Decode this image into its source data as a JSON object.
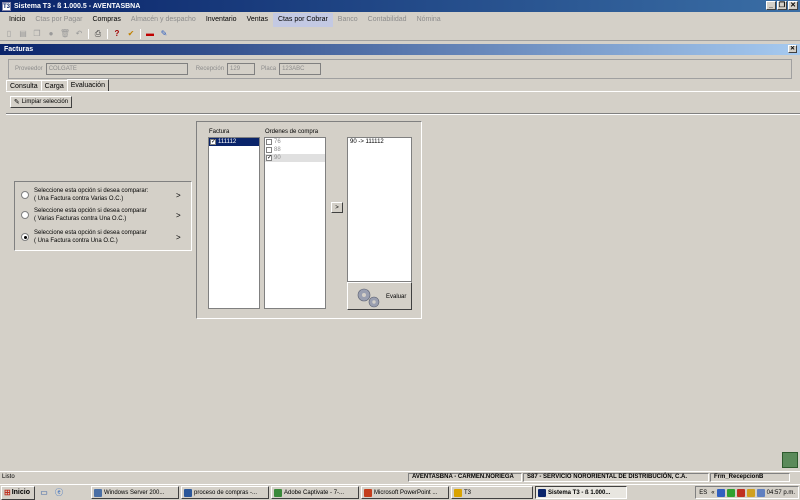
{
  "window": {
    "title": "Sistema T3 - ß 1.000.5 - AVENTASBNA",
    "app_icon_text": "T3",
    "min_label": "_",
    "restore_label": "❐",
    "close_label": "✕"
  },
  "menubar": {
    "items": [
      {
        "label": "Inicio",
        "state": "enabled"
      },
      {
        "label": "Ctas por Pagar",
        "state": "disabled"
      },
      {
        "label": "Compras",
        "state": "enabled"
      },
      {
        "label": "Almacén y despacho",
        "state": "disabled"
      },
      {
        "label": "Inventario",
        "state": "enabled"
      },
      {
        "label": "Ventas",
        "state": "enabled"
      },
      {
        "label": "Ctas por Cobrar",
        "state": "active"
      },
      {
        "label": "Banco",
        "state": "disabled"
      },
      {
        "label": "Contabilidad",
        "state": "disabled"
      },
      {
        "label": "Nómina",
        "state": "disabled"
      }
    ]
  },
  "toolbar": {
    "icons": [
      "new-icon",
      "save-icon",
      "copy-icon",
      "record-icon",
      "delete-icon",
      "undo-icon",
      "print-icon",
      "help-icon",
      "approve-icon",
      "exit-icon",
      "edit-icon"
    ]
  },
  "form": {
    "title": "Facturas",
    "close_label": "✕",
    "proveedor_label": "Proveedor",
    "proveedor_value": "COLGATE",
    "recepcion_label": "Recepción",
    "recepcion_value": "129",
    "placa_label": "Placa",
    "placa_value": "123ABC"
  },
  "tabs": [
    {
      "label": "Consulta",
      "selected": false
    },
    {
      "label": "Carga",
      "selected": false
    },
    {
      "label": "Evaluación",
      "selected": true
    }
  ],
  "clear_button": {
    "label": "Limpiar selección"
  },
  "options": [
    {
      "line1": "Seleccione esta opción si desea comparar:",
      "line2": "( Una Factura contra Varias O.C.)",
      "arrow": ">",
      "selected": false
    },
    {
      "line1": "Seleccione esta opción si desea comparar",
      "line2": "( Varias Facturas contra Una O.C.)",
      "arrow": ">",
      "selected": false
    },
    {
      "line1": "Seleccione esta opción si desea comparar",
      "line2": "( Una Factura contra Una O.C.)",
      "arrow": ">",
      "selected": true
    }
  ],
  "factura": {
    "label": "Factura",
    "items": [
      {
        "value": "111112",
        "checked": true
      }
    ]
  },
  "ordenes": {
    "label": "Ordenes de compra",
    "items": [
      {
        "value": "76",
        "checked": false
      },
      {
        "value": "88",
        "checked": false
      },
      {
        "value": "90",
        "checked": true
      }
    ]
  },
  "move_button": {
    "label": ">"
  },
  "results": {
    "items": [
      "90 -> 111112"
    ]
  },
  "evaluar_button": {
    "label": "Evaluar"
  },
  "status": {
    "left": "Listo",
    "user": "AVENTASBNA - CARMEN.NORIEGA",
    "company": "S87 - SERVICIO NORORIENTAL DE DISTRIBUCIÓN, C.A.",
    "form": "Frm_RecepcionB"
  },
  "taskbar": {
    "start_label": "Inicio",
    "tasks": [
      {
        "label": "Windows Server 200...",
        "active": false,
        "color": "#4a6fa5"
      },
      {
        "label": "proceso de compras -...",
        "active": false,
        "color": "#2b579a"
      },
      {
        "label": "Adobe Captivate - 7-...",
        "active": false,
        "color": "#3a8a3a"
      },
      {
        "label": "Microsoft PowerPoint ...",
        "active": false,
        "color": "#c43e1c"
      },
      {
        "label": "T3",
        "active": false,
        "color": "#d9a300"
      },
      {
        "label": "Sistema T3 - ß 1.000...",
        "active": true,
        "color": "#0a246a"
      }
    ],
    "language": "ES",
    "clock": "04:57 p.m."
  }
}
